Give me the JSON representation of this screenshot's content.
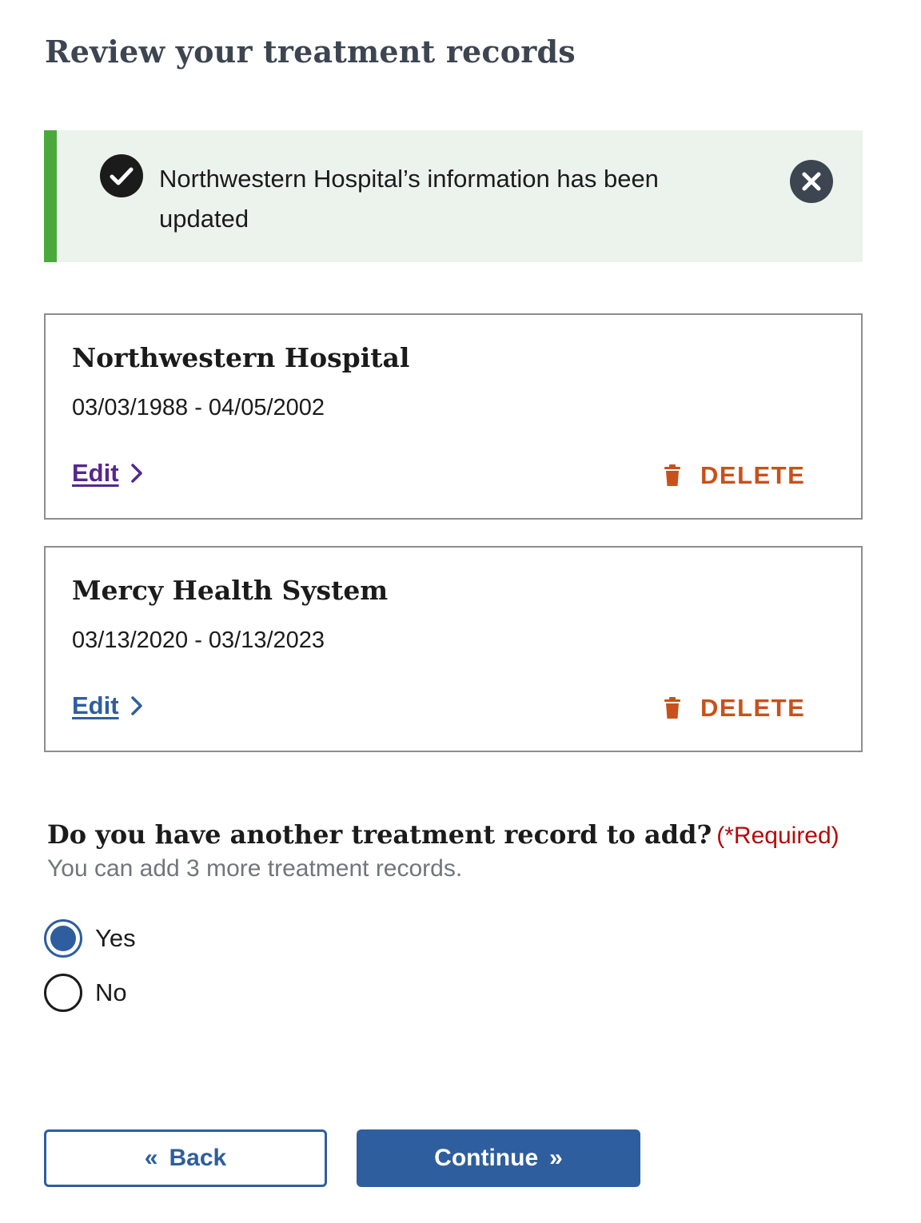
{
  "page": {
    "title": "Review your treatment records"
  },
  "alert": {
    "message": "Northwestern Hospital’s information has been updated",
    "status": "success",
    "icon": "check-circle-icon",
    "close_icon": "close-circle-icon",
    "accent_color": "#4aa93a",
    "background_color": "#ecf3ec"
  },
  "records": [
    {
      "name": "Northwestern Hospital",
      "dates": "03/03/1988 - 04/05/2002",
      "edit_label": "Edit",
      "delete_label": "DELETE",
      "edit_link_color": "#54278f"
    },
    {
      "name": "Mercy Health System",
      "dates": "03/13/2020 - 03/13/2023",
      "edit_label": "Edit",
      "delete_label": "DELETE",
      "edit_link_color": "#2e5e9e"
    }
  ],
  "question": {
    "text": "Do you have another treatment record to add?",
    "required_label": "(*Required)",
    "hint": "You can add 3 more treatment records.",
    "options": [
      {
        "label": "Yes",
        "checked": true
      },
      {
        "label": "No",
        "checked": false
      }
    ]
  },
  "buttons": {
    "back_label": "Back",
    "back_icon": "«",
    "continue_label": "Continue",
    "continue_icon": "»"
  },
  "colors": {
    "primary": "#2e5e9e",
    "delete": "#c8511b",
    "required": "#b50909",
    "heading": "#3d4551"
  }
}
